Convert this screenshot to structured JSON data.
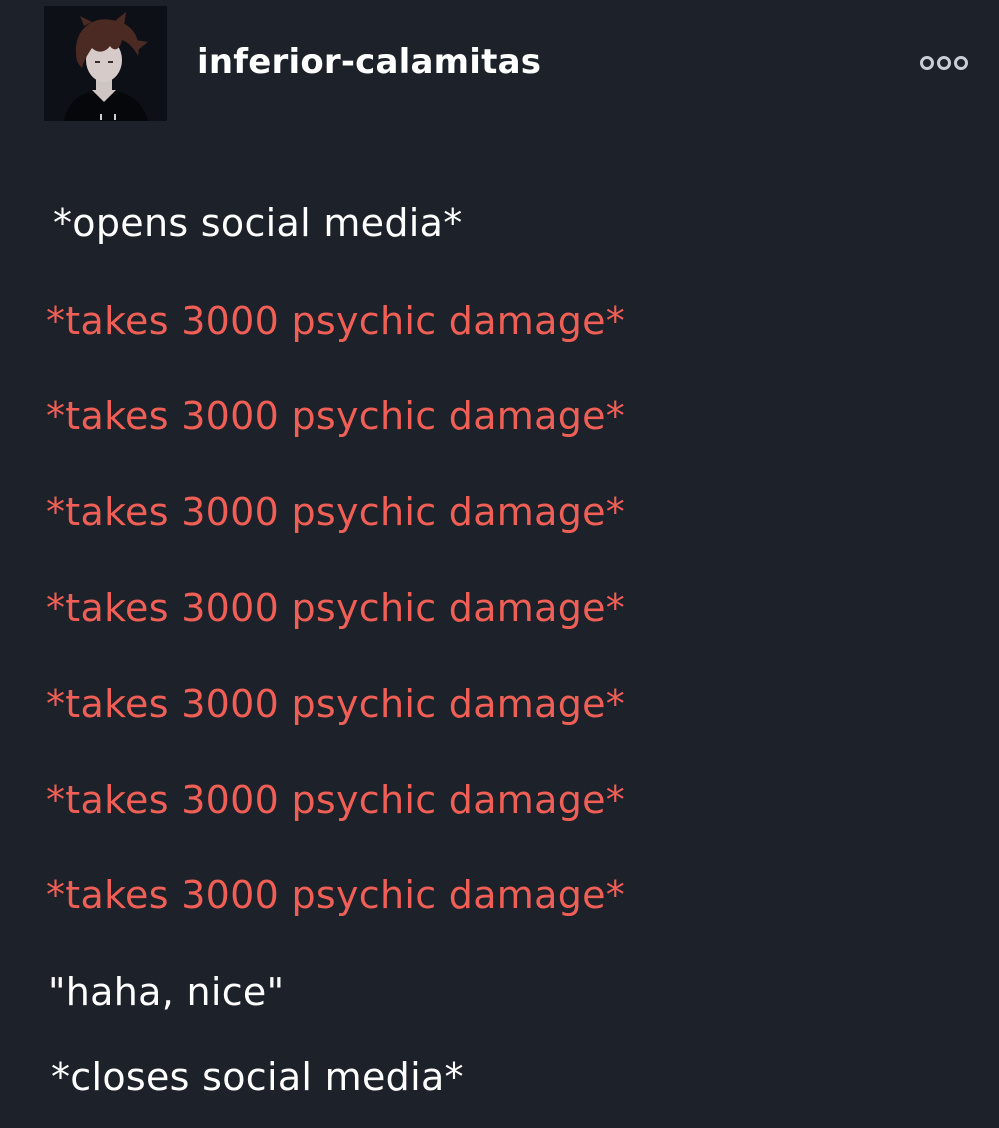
{
  "post": {
    "username": "inferior-calamitas",
    "more_icon": "more-horizontal-icon",
    "avatar_icon": "user-avatar",
    "lines": [
      {
        "text": "*opens social media*",
        "tone": "white"
      },
      {
        "text": "*takes 3000 psychic damage*",
        "tone": "red"
      },
      {
        "text": "*takes 3000 psychic damage*",
        "tone": "red"
      },
      {
        "text": "*takes 3000 psychic damage*",
        "tone": "red"
      },
      {
        "text": "*takes 3000 psychic damage*",
        "tone": "red"
      },
      {
        "text": "*takes 3000 psychic damage*",
        "tone": "red"
      },
      {
        "text": "*takes 3000 psychic damage*",
        "tone": "red"
      },
      {
        "text": "*takes 3000 psychic damage*",
        "tone": "red"
      },
      {
        "text": "\"haha, nice\"",
        "tone": "white"
      },
      {
        "text": "*closes social media*",
        "tone": "white"
      }
    ]
  },
  "colors": {
    "background": "#1d212a",
    "text_white": "#ffffff",
    "text_red": "#f05f55"
  }
}
